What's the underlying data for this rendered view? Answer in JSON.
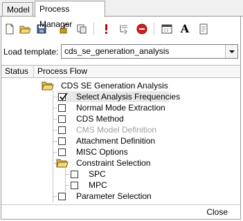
{
  "tabs": [
    {
      "label": "Model",
      "active": false
    },
    {
      "label": "Process Manager",
      "active": true
    }
  ],
  "toolbar": {
    "icons": [
      "new-document-icon",
      "open-folder-icon",
      "save-icon",
      "unlock-icon",
      "copy-icon",
      "warning-icon",
      "step-forward-icon",
      "stop-icon",
      "calendar-icon",
      "font-icon",
      "notes-icon"
    ],
    "font_glyph": "A"
  },
  "template": {
    "label": "Load template:",
    "value": "cds_se_generation_analysis"
  },
  "columns": [
    "Status",
    "Process Flow"
  ],
  "tree": {
    "root": "CDS SE Generation Analysis",
    "items": [
      {
        "label": "Select Analysis Frequencies",
        "checked": true,
        "selected": true,
        "disabled": false
      },
      {
        "label": "Normal Mode Extraction",
        "checked": false,
        "disabled": false
      },
      {
        "label": "CDS Method",
        "checked": false,
        "disabled": false
      },
      {
        "label": "CMS Model Definition",
        "checked": false,
        "disabled": true
      },
      {
        "label": "Attachment Definition",
        "checked": false,
        "disabled": false
      },
      {
        "label": "MISC Options",
        "checked": false,
        "disabled": false
      }
    ],
    "group": {
      "label": "Constraint Selection",
      "children": [
        {
          "label": "SPC",
          "checked": false
        },
        {
          "label": "MPC",
          "checked": false
        }
      ]
    },
    "last": {
      "label": "Parameter Selection",
      "checked": false
    }
  },
  "footer": {
    "close_label": "Close"
  },
  "colors": {
    "border": "#999999",
    "disabled_text": "#a0a0a0",
    "selected_row": "#e8e8e8",
    "warning": "#cc0000"
  }
}
